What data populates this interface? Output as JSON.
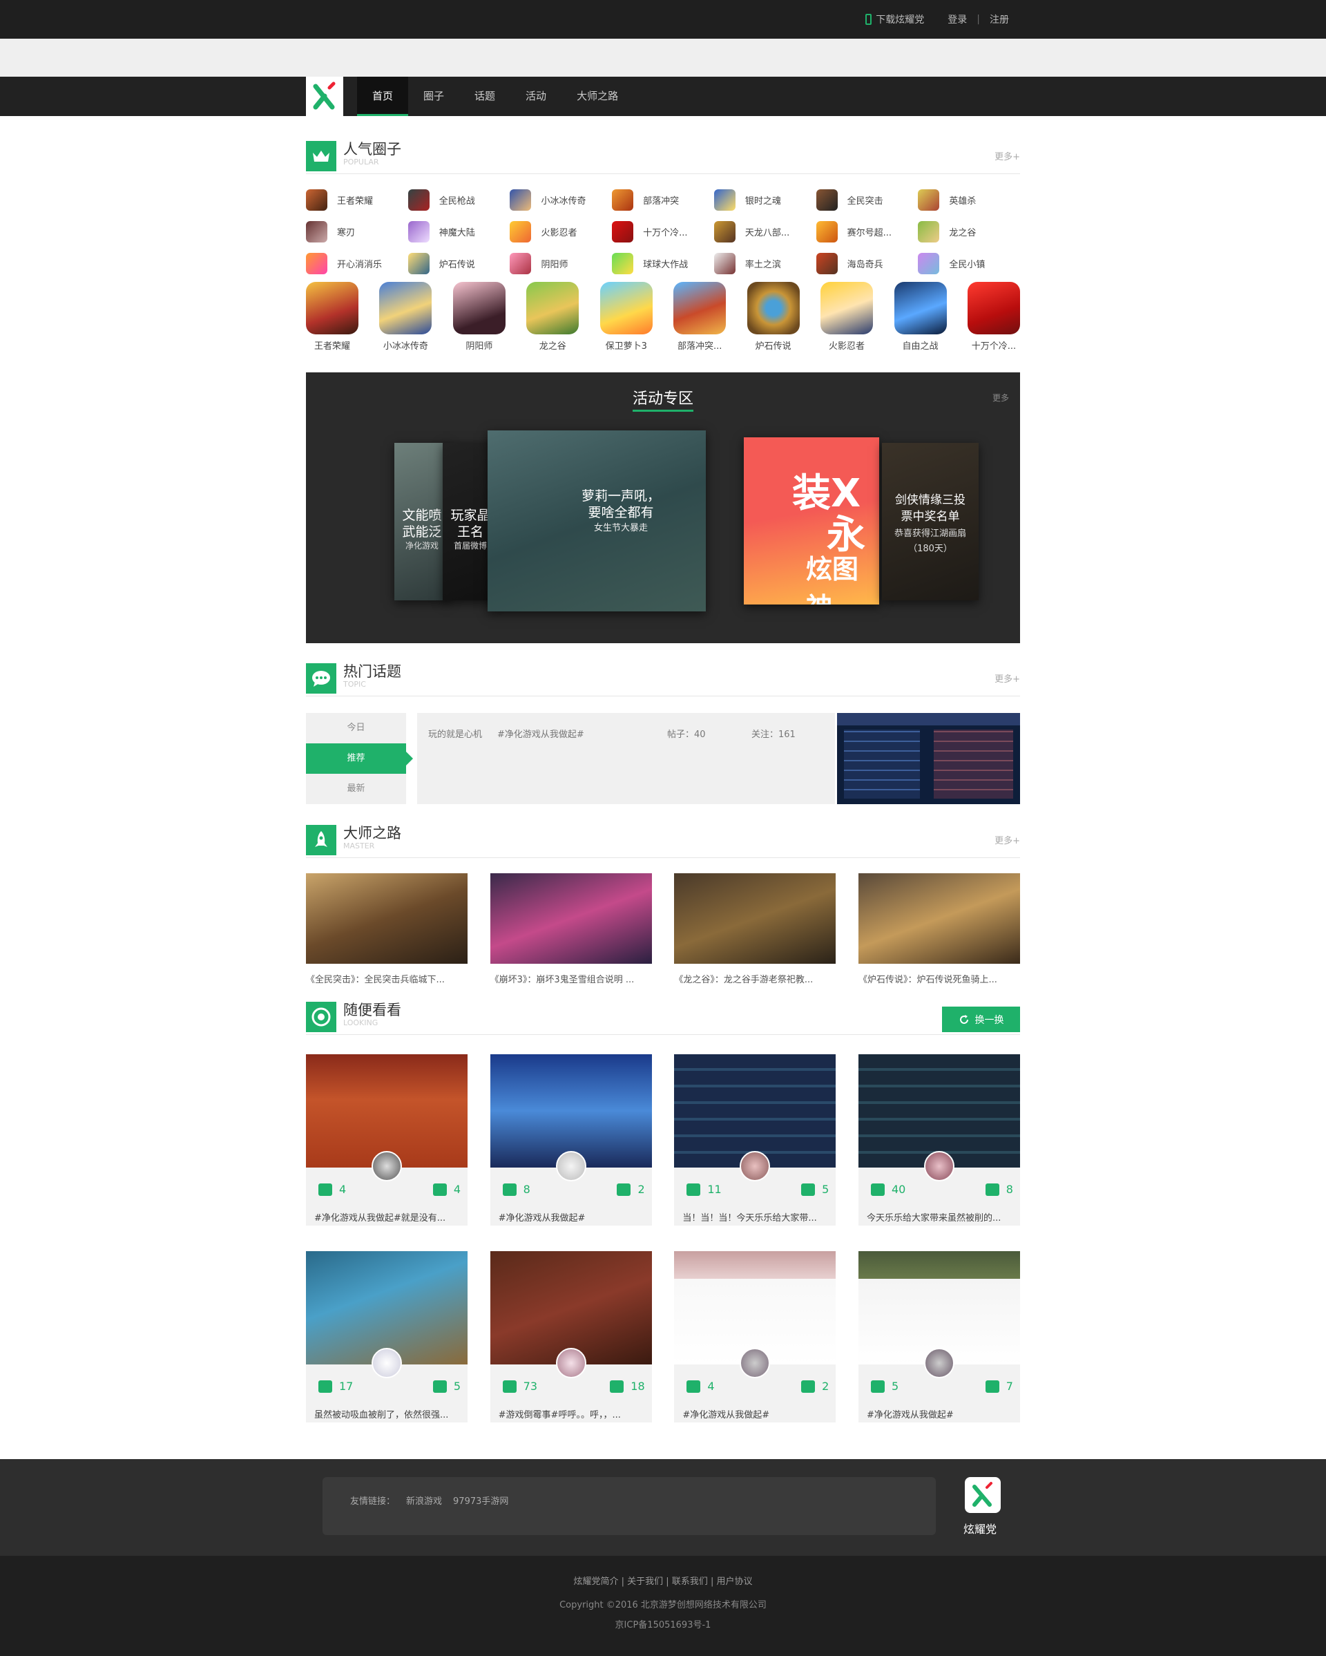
{
  "header": {
    "download_label": "下载炫耀党",
    "login": "登录",
    "divider": "|",
    "register": "注册"
  },
  "nav": {
    "items": [
      "首页",
      "圈子",
      "话题",
      "活动",
      "大师之路"
    ]
  },
  "popular": {
    "title": "人气圈子",
    "subtitle": "POPULAR",
    "more": "更多+",
    "rows": [
      [
        "王者荣耀",
        "全民枪战",
        "小冰冰传奇",
        "部落冲突",
        "银时之魂",
        "全民突击",
        "英雄杀"
      ],
      [
        "寒刃",
        "神魔大陆",
        "火影忍者",
        "十万个冷...",
        "天龙八部...",
        "赛尔号超...",
        "龙之谷"
      ],
      [
        "开心消消乐",
        "炉石传说",
        "阴阳师",
        "球球大作战",
        "率土之滨",
        "海岛奇兵",
        "全民小镇"
      ]
    ],
    "apps": [
      "王者荣耀",
      "小冰冰传奇",
      "阴阳师",
      "龙之谷",
      "保卫萝卜3",
      "部落冲突...",
      "炉石传说",
      "火影忍者",
      "自由之战",
      "十万个冷..."
    ]
  },
  "activity": {
    "title": "活动专区",
    "more": "更多",
    "cards": [
      {
        "t1": "文能喷",
        "t2": "武能泛",
        "t3": "净化游戏"
      },
      {
        "t1": "玩家晶",
        "t2": "王名",
        "t3": "首届微博"
      },
      {
        "t1": "萝莉一声吼，",
        "t2": "要啥全都有",
        "t3": "女生节大暴走"
      },
      {
        "t1": "装X",
        "t2": "永",
        "t3": "炫图神"
      },
      {
        "t1": "剑侠情缘三投",
        "t2": "票中奖名单",
        "t3": "恭喜获得江湖画扇",
        "t4": "（180天）"
      }
    ]
  },
  "topics": {
    "title": "热门话题",
    "subtitle": "TOPIC",
    "more": "更多+",
    "tabs": [
      "今日",
      "推荐",
      "最新"
    ],
    "item": {
      "intro": "玩的就是心机",
      "tag": "#净化游戏从我做起#",
      "posts": "帖子：40",
      "follows": "关注：161"
    }
  },
  "master": {
    "title": "大师之路",
    "subtitle": "MASTER",
    "more": "更多+",
    "items": [
      "《全民突击》：全民突击兵临城下...",
      "《崩坏3》：崩坏3鬼圣雪组合说明 ...",
      "《龙之谷》：龙之谷手游老祭祀教...",
      "《炉石传说》：炉石传说死鱼骑上..."
    ]
  },
  "looking": {
    "title": "随便看看",
    "subtitle": "LOOKING",
    "swap": "换一换",
    "cards": [
      {
        "up": "4",
        "down": "4",
        "text": "#净化游戏从我做起#就是没有..."
      },
      {
        "up": "8",
        "down": "2",
        "text": "#净化游戏从我做起#"
      },
      {
        "up": "11",
        "down": "5",
        "text": "当！当！当！今天乐乐给大家带..."
      },
      {
        "up": "40",
        "down": "8",
        "text": "今天乐乐给大家带来虽然被削的..."
      },
      {
        "up": "17",
        "down": "5",
        "text": "虽然被动吸血被削了，依然很强..."
      },
      {
        "up": "73",
        "down": "18",
        "text": "#游戏倒霉事#呼呼。。呼，，..."
      },
      {
        "up": "4",
        "down": "2",
        "text": "#净化游戏从我做起#"
      },
      {
        "up": "5",
        "down": "7",
        "text": "#净化游戏从我做起#"
      }
    ]
  },
  "footer": {
    "friend_label": "友情链接：",
    "friends": [
      "新浪游戏",
      "97973手游网"
    ],
    "brand": "炫耀党",
    "links": "炫耀党简介 | 关于我们 | 联系我们 | 用户协议",
    "copyright": "Copyright ©2016 北京游梦创想网络技术有限公司",
    "icp": "京ICP备15051693号-1"
  },
  "colors": {
    "accent": "#1fb16a",
    "dark": "#222222"
  }
}
